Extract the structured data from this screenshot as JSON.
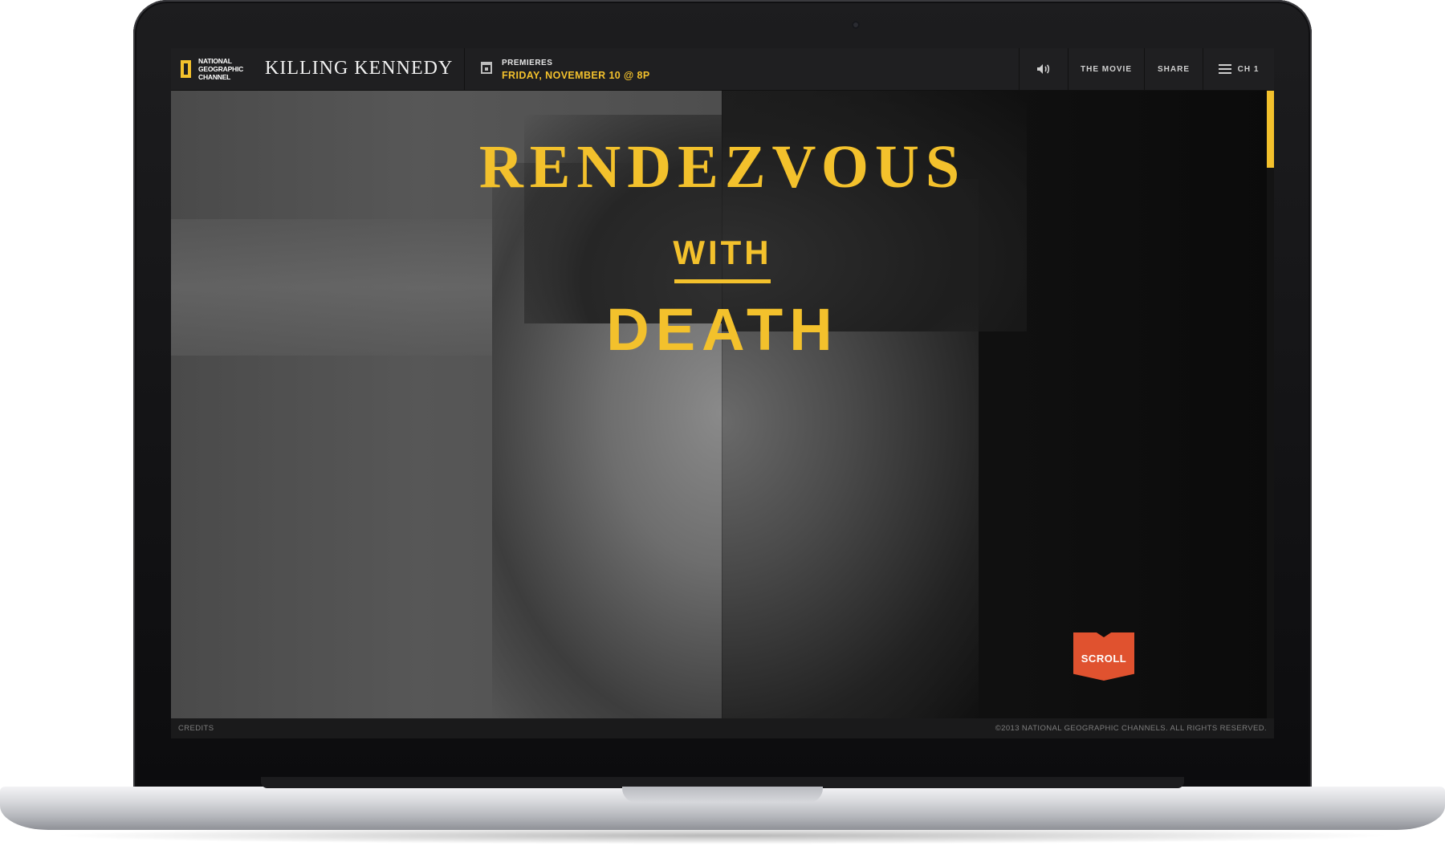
{
  "header": {
    "logo": {
      "line1": "NATIONAL",
      "line2": "GEOGRAPHIC",
      "line3": "CHANNEL"
    },
    "site_title": "KILLING KENNEDY",
    "premieres_label": "PREMIERES",
    "premiere_date": "FRIDAY, NOVEMBER 10 @ 8P",
    "nav": {
      "movie": "THE MOVIE",
      "share": "SHARE",
      "chapter": "CH 1"
    }
  },
  "hero": {
    "line1": "RENDEZVOUS",
    "line2": "WITH",
    "line3": "DEATH",
    "scroll_label": "SCROLL"
  },
  "footer": {
    "credits": "CREDITS",
    "copyright": "©2013 NATIONAL GEOGRAPHIC CHANNELS. ALL RIGHTS RESERVED."
  },
  "colors": {
    "accent": "#f3c12c",
    "scroll": "#e0522f"
  },
  "icons": [
    "calendar-icon",
    "speaker-icon",
    "menu-icon",
    "national-geographic-logo"
  ]
}
